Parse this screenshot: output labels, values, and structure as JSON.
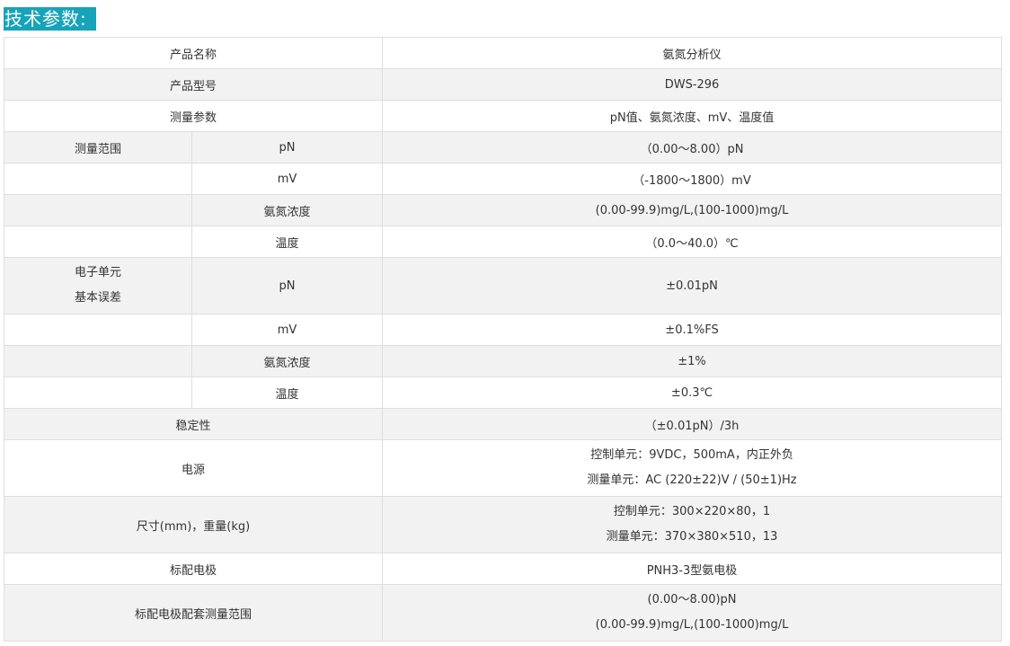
{
  "title": "技术参数:",
  "rows": [
    {
      "label": "产品名称",
      "value": "氨氮分析仪"
    },
    {
      "label": "产品型号",
      "value": "DWS-296"
    },
    {
      "label": "测量参数",
      "value": "pN值、氨氮浓度、mV、温度值"
    },
    {
      "group": "测量范围",
      "sub": "pN",
      "value": "（0.00～8.00）pN"
    },
    {
      "sub": "mV",
      "value": "（-1800～1800）mV"
    },
    {
      "sub": "氨氮浓度",
      "value": "(0.00-99.9)mg/L,(100-1000)mg/L"
    },
    {
      "sub": "温度",
      "value": "（0.0～40.0）℃"
    },
    {
      "group_lines": [
        "电子单元",
        "基本误差"
      ],
      "sub": "pN",
      "value": "±0.01pN"
    },
    {
      "sub": "mV",
      "value": "±0.1%FS"
    },
    {
      "sub": "氨氮浓度",
      "value": "±1%"
    },
    {
      "sub": "温度",
      "value": "±0.3℃"
    },
    {
      "label": "稳定性",
      "value": "（±0.01pN）/3h"
    },
    {
      "label": "电源",
      "value_lines": [
        "控制单元：9VDC，500mA，内正外负",
        "测量单元：AC (220±22)V / (50±1)Hz"
      ]
    },
    {
      "label": "尺寸(mm)，重量(kg)",
      "value_lines": [
        "控制单元：300×220×80，1",
        "测量单元：370×380×510，13"
      ]
    },
    {
      "label": "标配电极",
      "value": "PNH3-3型氨电极"
    },
    {
      "label": "标配电极配套测量范围",
      "value_lines": [
        "(0.00～8.00)pN",
        "(0.00-99.9)mg/L,(100-1000)mg/L"
      ]
    }
  ]
}
